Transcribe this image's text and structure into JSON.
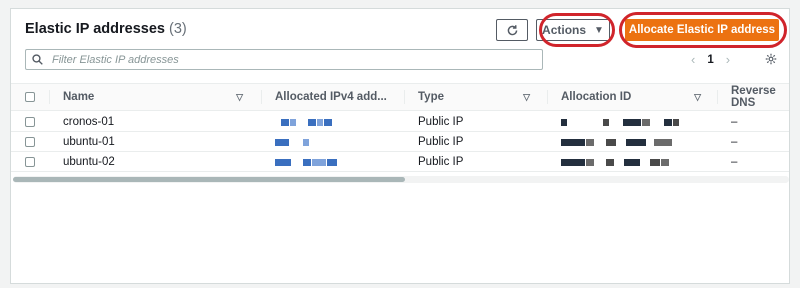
{
  "header": {
    "title": "Elastic IP addresses",
    "count": "(3)",
    "actions_label": "Actions",
    "allocate_label": "Allocate Elastic IP address"
  },
  "search": {
    "placeholder": "Filter Elastic IP addresses"
  },
  "pagination": {
    "current_page": "1"
  },
  "table": {
    "columns": [
      "Name",
      "Allocated IPv4 add...",
      "Type",
      "Allocation ID",
      "Reverse DNS"
    ],
    "rows": [
      {
        "name": "cronos-01",
        "type": "Public IP",
        "reverse_dns": "–"
      },
      {
        "name": "ubuntu-01",
        "type": "Public IP",
        "reverse_dns": "–"
      },
      {
        "name": "ubuntu-02",
        "type": "Public IP",
        "reverse_dns": "–"
      }
    ]
  },
  "colors": {
    "primary_button": "#ec7211",
    "annotation": "#d0242b",
    "redaction_blue": "#3a6fbf",
    "redaction_dark": "#232f3e"
  },
  "icons": [
    "refresh-icon",
    "caret-down-icon",
    "search-icon",
    "chevron-left-icon",
    "chevron-right-icon",
    "settings-icon",
    "sort-icon"
  ]
}
